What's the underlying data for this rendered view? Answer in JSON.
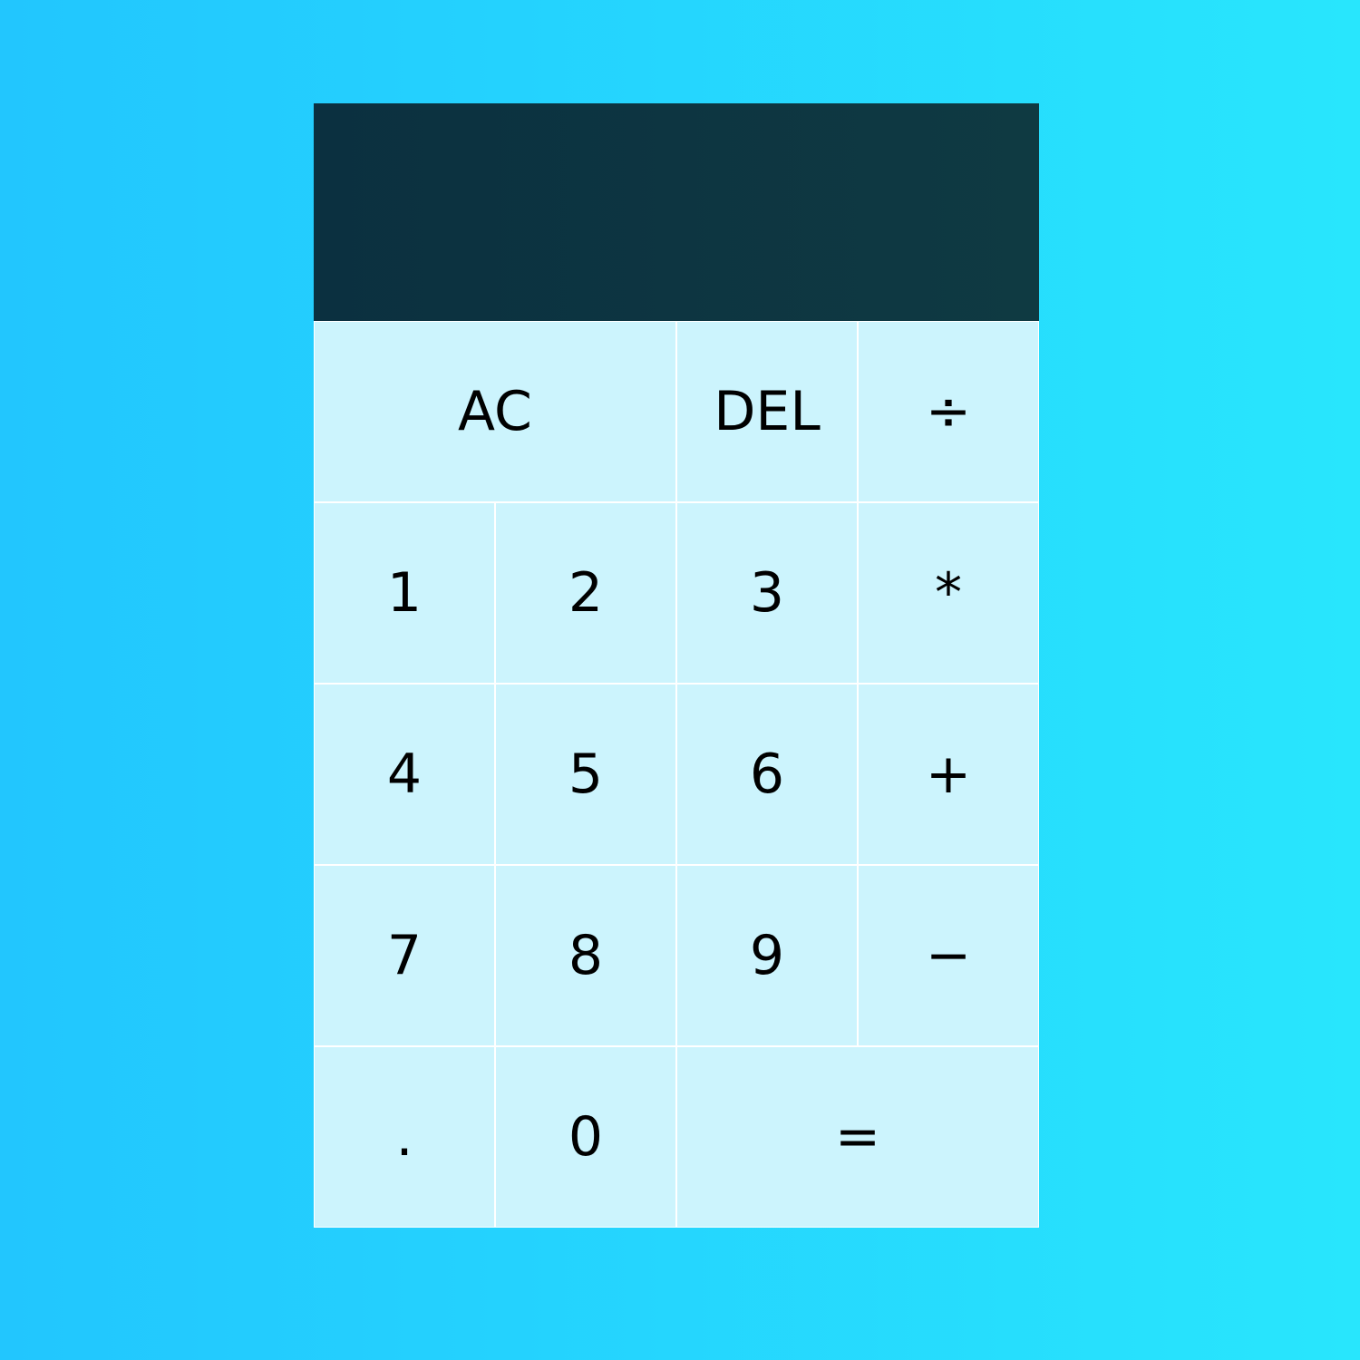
{
  "display": {
    "previous_operand": "",
    "current_operand": ""
  },
  "buttons": {
    "clear": "AC",
    "delete": "DEL",
    "divide": "÷",
    "one": "1",
    "two": "2",
    "three": "3",
    "multiply": "*",
    "four": "4",
    "five": "5",
    "six": "6",
    "add": "+",
    "seven": "7",
    "eight": "8",
    "nine": "9",
    "subtract": "−",
    "decimal": ".",
    "zero": "0",
    "equals": "="
  },
  "colors": {
    "background_left": "#22c6fe",
    "background_right": "#28e6fd",
    "display_background": "#0b3040",
    "button_background": "#ccf4fd",
    "button_border": "#ffffff",
    "button_text": "#000000"
  }
}
